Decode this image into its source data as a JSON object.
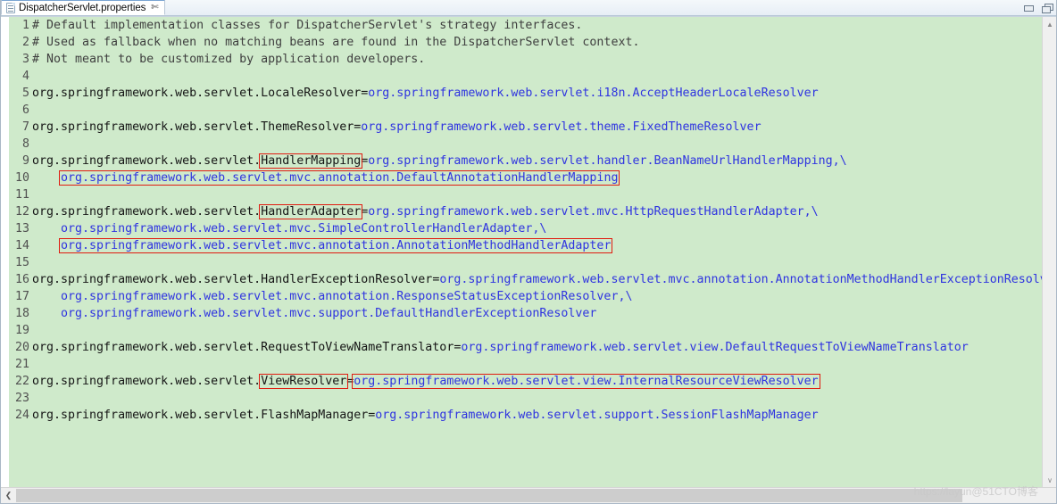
{
  "window": {
    "minimize_label": "Minimize",
    "maximize_label": "Restore",
    "watermark": "https://layun@51CTO博客"
  },
  "tab": {
    "label": "DispatcherServlet.properties",
    "close_glyph": "✄",
    "icon": "properties-file-icon"
  },
  "scrollbars": {
    "v_up_glyph": "▲",
    "v_down_glyph": "∨",
    "h_left_glyph": "❮",
    "h_right_glyph": "❯"
  },
  "editor": {
    "language": "properties",
    "background_color": "#cfeacb",
    "key_color": "#151515",
    "value_color": "#2f34e0",
    "comment_color": "#3f3f3f",
    "highlight_color": "#e01b10",
    "lines": [
      {
        "no": "1",
        "segments": [
          {
            "text": "# Default implementation classes for DispatcherServlet's strategy interfaces.",
            "style": "comment"
          }
        ]
      },
      {
        "no": "2",
        "segments": [
          {
            "text": "# Used as fallback when no matching beans are found in the DispatcherServlet context.",
            "style": "comment"
          }
        ]
      },
      {
        "no": "3",
        "segments": [
          {
            "text": "# Not meant to be customized by application developers.",
            "style": "comment"
          }
        ]
      },
      {
        "no": "4",
        "segments": []
      },
      {
        "no": "5",
        "segments": [
          {
            "text": "org.springframework.web.servlet.LocaleResolver",
            "style": "key"
          },
          {
            "text": "=",
            "style": "eq"
          },
          {
            "text": "org.springframework.web.servlet.i18n.AcceptHeaderLocaleResolver",
            "style": "val"
          }
        ]
      },
      {
        "no": "6",
        "segments": []
      },
      {
        "no": "7",
        "segments": [
          {
            "text": "org.springframework.web.servlet.ThemeResolver",
            "style": "key"
          },
          {
            "text": "=",
            "style": "eq"
          },
          {
            "text": "org.springframework.web.servlet.theme.FixedThemeResolver",
            "style": "val"
          }
        ]
      },
      {
        "no": "8",
        "segments": []
      },
      {
        "no": "9",
        "segments": [
          {
            "text": "org.springframework.web.servlet.",
            "style": "key"
          },
          {
            "text": "HandlerMapping",
            "style": "key",
            "boxed": true
          },
          {
            "text": "=",
            "style": "eq"
          },
          {
            "text": "org.springframework.web.servlet.handler.BeanNameUrlHandlerMapping,\\",
            "style": "val"
          }
        ]
      },
      {
        "no": "10",
        "segments": [
          {
            "text": "    ",
            "style": "val"
          },
          {
            "text": "org.springframework.web.servlet.mvc.annotation.DefaultAnnotationHandlerMapping",
            "style": "val",
            "boxed": true
          }
        ]
      },
      {
        "no": "11",
        "segments": []
      },
      {
        "no": "12",
        "segments": [
          {
            "text": "org.springframework.web.servlet.",
            "style": "key"
          },
          {
            "text": "HandlerAdapter",
            "style": "key",
            "boxed": true
          },
          {
            "text": "=",
            "style": "eq"
          },
          {
            "text": "org.springframework.web.servlet.mvc.HttpRequestHandlerAdapter,\\",
            "style": "val"
          }
        ]
      },
      {
        "no": "13",
        "segments": [
          {
            "text": "    org.springframework.web.servlet.mvc.SimpleControllerHandlerAdapter,\\",
            "style": "val"
          }
        ]
      },
      {
        "no": "14",
        "segments": [
          {
            "text": "    ",
            "style": "val"
          },
          {
            "text": "org.springframework.web.servlet.mvc.annotation.AnnotationMethodHandlerAdapter",
            "style": "val",
            "boxed": true
          }
        ]
      },
      {
        "no": "15",
        "segments": []
      },
      {
        "no": "16",
        "segments": [
          {
            "text": "org.springframework.web.servlet.HandlerExceptionResolver",
            "style": "key"
          },
          {
            "text": "=",
            "style": "eq"
          },
          {
            "text": "org.springframework.web.servlet.mvc.annotation.AnnotationMethodHandlerExceptionResolver,\\",
            "style": "val"
          }
        ]
      },
      {
        "no": "17",
        "segments": [
          {
            "text": "    org.springframework.web.servlet.mvc.annotation.ResponseStatusExceptionResolver,\\",
            "style": "val"
          }
        ]
      },
      {
        "no": "18",
        "segments": [
          {
            "text": "    org.springframework.web.servlet.mvc.support.DefaultHandlerExceptionResolver",
            "style": "val"
          }
        ]
      },
      {
        "no": "19",
        "segments": []
      },
      {
        "no": "20",
        "segments": [
          {
            "text": "org.springframework.web.servlet.RequestToViewNameTranslator",
            "style": "key"
          },
          {
            "text": "=",
            "style": "eq"
          },
          {
            "text": "org.springframework.web.servlet.view.DefaultRequestToViewNameTranslator",
            "style": "val"
          }
        ]
      },
      {
        "no": "21",
        "segments": []
      },
      {
        "no": "22",
        "segments": [
          {
            "text": "org.springframework.web.servlet.",
            "style": "key"
          },
          {
            "text": "ViewResolver",
            "style": "key",
            "boxed": true
          },
          {
            "text": "=",
            "style": "eq"
          },
          {
            "text": "org.springframework.web.servlet.view.InternalResourceViewResolver",
            "style": "val",
            "boxed": true
          }
        ]
      },
      {
        "no": "23",
        "segments": []
      },
      {
        "no": "24",
        "segments": [
          {
            "text": "org.springframework.web.servlet.FlashMapManager",
            "style": "key"
          },
          {
            "text": "=",
            "style": "eq"
          },
          {
            "text": "org.springframework.web.servlet.support.SessionFlashMapManager",
            "style": "val"
          }
        ]
      }
    ]
  }
}
